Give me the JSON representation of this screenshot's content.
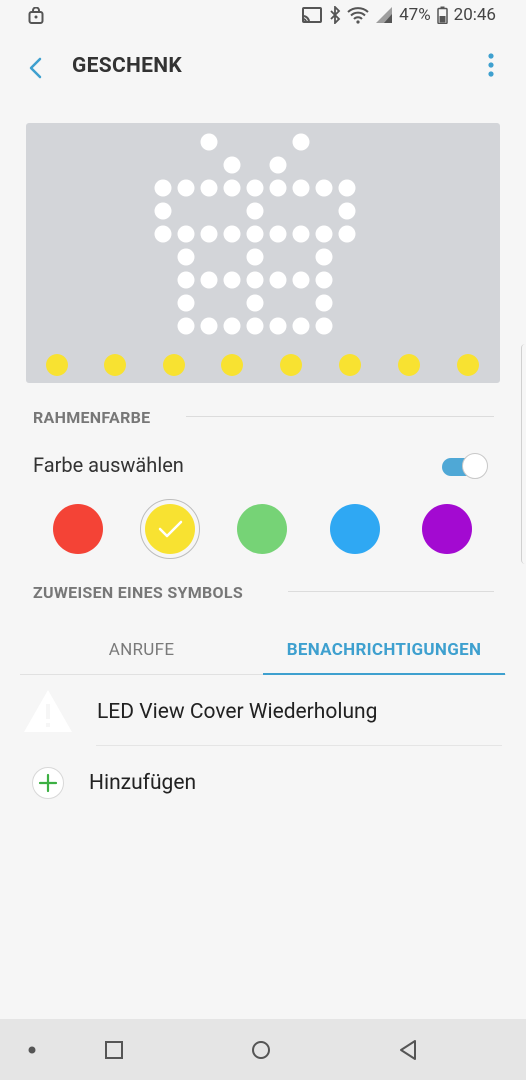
{
  "status_bar": {
    "battery_percent": "47%",
    "time": "20:46",
    "icons": [
      "cast-icon",
      "bluetooth-icon",
      "wifi-icon",
      "signal-icon",
      "battery-icon"
    ]
  },
  "header": {
    "title": "GESCHENK",
    "back_icon": "back-arrow-icon",
    "more_icon": "more-vertical-icon"
  },
  "preview": {
    "icon": "gift-dot-matrix",
    "background_color": "#d3d5d9",
    "dot_color": "#ffffff",
    "frame_dot_color": "#f8e231"
  },
  "frame_color": {
    "section_title": "RAHMENFARBE",
    "toggle_label": "Farbe auswählen",
    "toggle_on": true,
    "swatches": [
      {
        "name": "red",
        "color": "#f44336",
        "selected": false
      },
      {
        "name": "yellow",
        "color": "#f8e231",
        "selected": true
      },
      {
        "name": "green",
        "color": "#76d376",
        "selected": false
      },
      {
        "name": "blue",
        "color": "#2fa8f3",
        "selected": false
      },
      {
        "name": "purple",
        "color": "#a30ad1",
        "selected": false
      }
    ]
  },
  "assign_symbol": {
    "section_title": "ZUWEISEN EINES SYMBOLS",
    "tabs": [
      {
        "label": "ANRUFE",
        "active": false
      },
      {
        "label": "BENACHRICHTIGUNGEN",
        "active": true
      }
    ],
    "items": [
      {
        "label": "LED View Cover Wiederholung",
        "icon": "warning-icon"
      }
    ],
    "add_label": "Hinzufügen"
  },
  "nav_bar": {
    "buttons": [
      "dot-icon",
      "recents-icon",
      "home-icon",
      "back-icon"
    ]
  }
}
